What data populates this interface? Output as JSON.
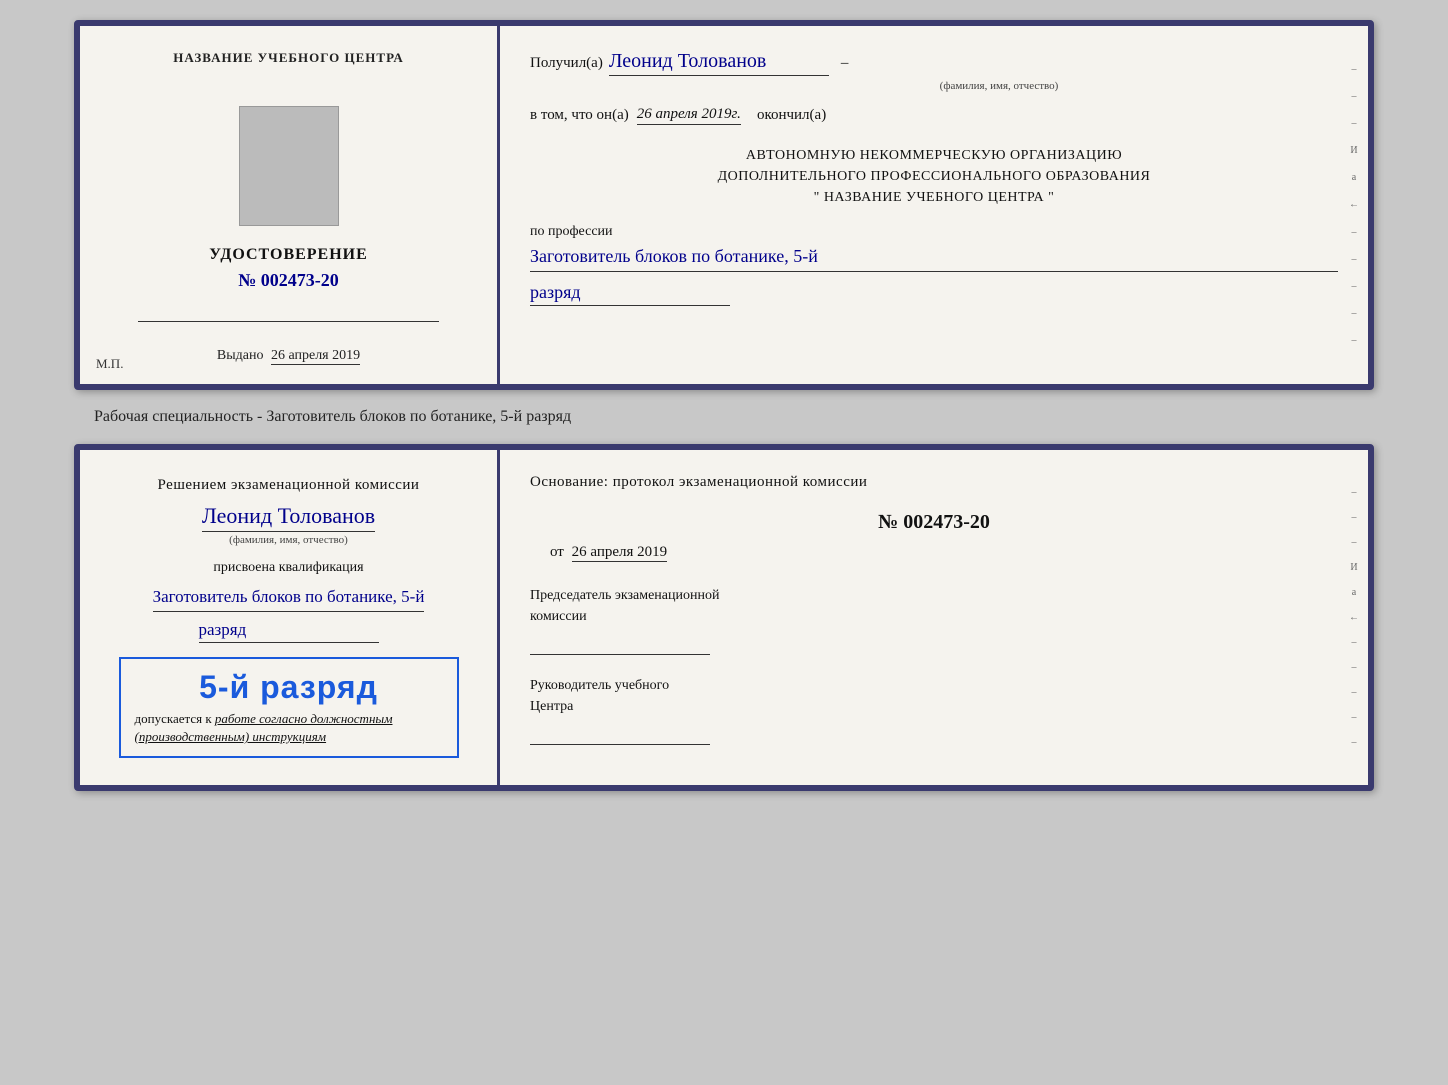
{
  "top_card": {
    "left": {
      "training_center_label": "НАЗВАНИЕ УЧЕБНОГО ЦЕНТРА",
      "cert_title": "УДОСТОВЕРЕНИЕ",
      "cert_number_prefix": "№",
      "cert_number": "002473-20",
      "issued_label": "Выдано",
      "issued_date": "26 апреля 2019",
      "mp_label": "М.П."
    },
    "right": {
      "received_label": "Получил(а)",
      "recipient_name": "Леонид Толованов",
      "fio_label": "(фамилия, имя, отчество)",
      "date_intro": "в том, что он(а)",
      "date_value": "26 апреля 2019г.",
      "finished_label": "окончил(а)",
      "org_line1": "АВТОНОМНУЮ НЕКОММЕРЧЕСКУЮ ОРГАНИЗАЦИЮ",
      "org_line2": "ДОПОЛНИТЕЛЬНОГО ПРОФЕССИОНАЛЬНОГО ОБРАЗОВАНИЯ",
      "org_line3": "\"  НАЗВАНИЕ УЧЕБНОГО ЦЕНТРА  \"",
      "profession_label": "по профессии",
      "profession_value": "Заготовитель блоков по ботанике, 5-й",
      "razryad_value": "разряд"
    }
  },
  "description": "Рабочая специальность - Заготовитель блоков по ботанике, 5-й разряд",
  "bottom_card": {
    "left": {
      "commission_intro": "Решением экзаменационной комиссии",
      "person_name": "Леонид Толованов",
      "fio_label": "(фамилия, имя, отчество)",
      "qualification_label": "присвоена квалификация",
      "qualification_value": "Заготовитель блоков по ботанике, 5-й",
      "razryad_value": "разряд",
      "stamp_grade": "5-й разряд",
      "stamp_admit_prefix": "допускается к",
      "stamp_admit_italic": "работе согласно должностным",
      "stamp_admit_end": "(производственным) инструкциям"
    },
    "right": {
      "basis_heading": "Основание: протокол экзаменационной комиссии",
      "protocol_number": "№  002473-20",
      "from_date_prefix": "от",
      "from_date": "26 апреля 2019",
      "chairman_title_line1": "Председатель экзаменационной",
      "chairman_title_line2": "комиссии",
      "director_title_line1": "Руководитель учебного",
      "director_title_line2": "Центра"
    }
  },
  "side_chars": [
    "И",
    "а",
    "←",
    "–",
    "–",
    "–",
    "–",
    "–"
  ]
}
